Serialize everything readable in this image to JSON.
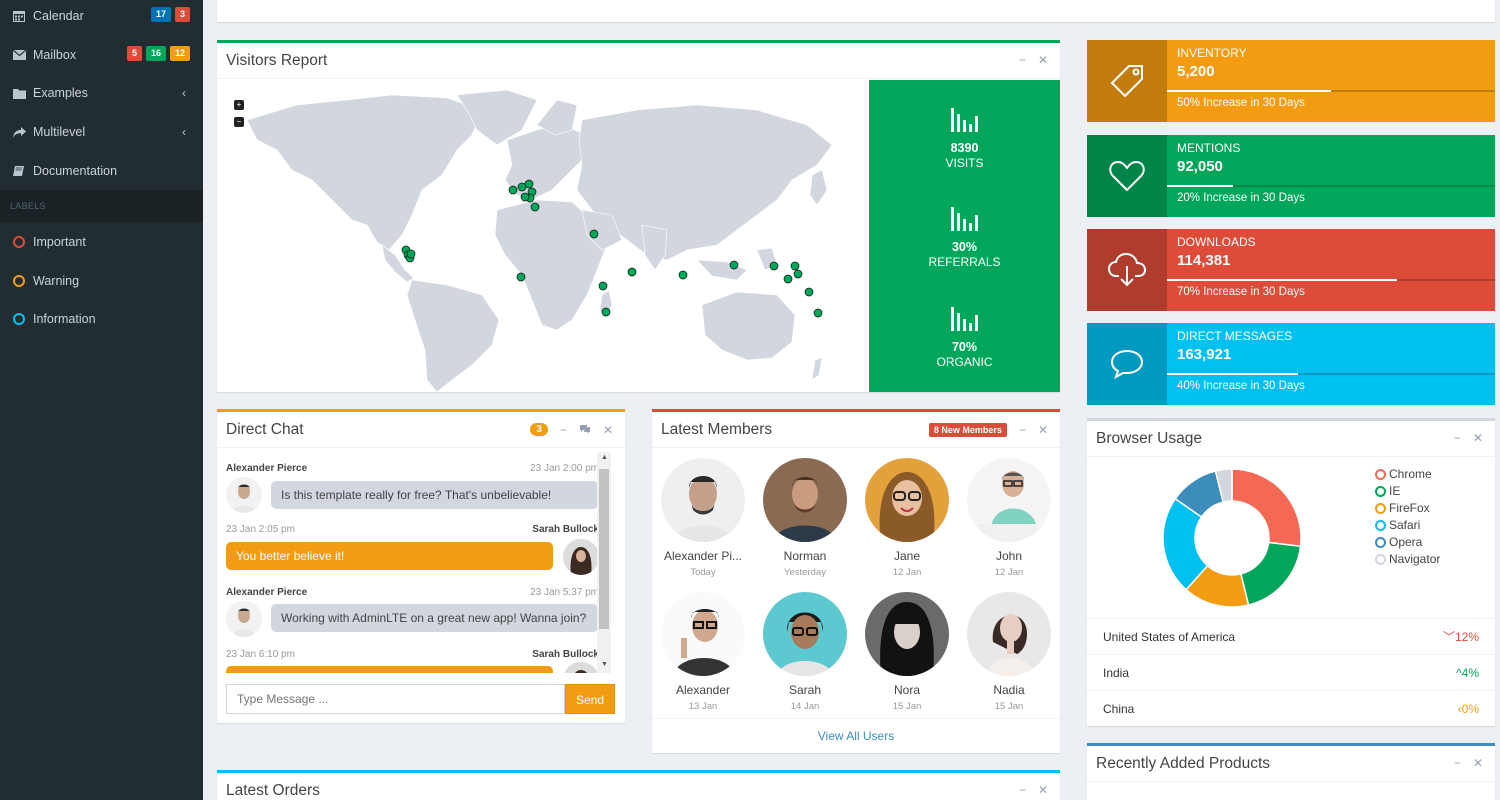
{
  "sidebar": {
    "items": [
      {
        "label": "Calendar",
        "icon": "calendar-icon",
        "badges": [
          {
            "text": "17",
            "color": "#0073b7"
          },
          {
            "text": "3",
            "color": "#dd4b39"
          }
        ]
      },
      {
        "label": "Mailbox",
        "icon": "envelope-icon",
        "badges": [
          {
            "text": "5",
            "color": "#dd4b39"
          },
          {
            "text": "16",
            "color": "#00a65a"
          },
          {
            "text": "12",
            "color": "#f39c12"
          }
        ]
      },
      {
        "label": "Examples",
        "icon": "folder-icon"
      },
      {
        "label": "Multilevel",
        "icon": "share-icon"
      },
      {
        "label": "Documentation",
        "icon": "book-icon"
      }
    ],
    "labels_header": "LABELS",
    "labels": [
      {
        "label": "Important",
        "color": "#dd4b39"
      },
      {
        "label": "Warning",
        "color": "#f39c12"
      },
      {
        "label": "Information",
        "color": "#00c0ef"
      }
    ]
  },
  "visitors": {
    "title": "Visitors Report",
    "stats": [
      {
        "value": "8390",
        "label": "VISITS"
      },
      {
        "value": "30%",
        "label": "REFERRALS"
      },
      {
        "value": "70%",
        "label": "ORGANIC"
      }
    ]
  },
  "info_boxes": [
    {
      "title": "INVENTORY",
      "number": "5,200",
      "desc": "50% Increase in 30 Days",
      "progress": 0.5,
      "color": "#f39c12",
      "icon": "tag-icon"
    },
    {
      "title": "MENTIONS",
      "number": "92,050",
      "desc": "20% Increase in 30 Days",
      "progress": 0.2,
      "color": "#00a65a",
      "icon": "heart-icon"
    },
    {
      "title": "DOWNLOADS",
      "number": "114,381",
      "desc": "70% Increase in 30 Days",
      "progress": 0.7,
      "color": "#dd4b39",
      "icon": "cloud-download-icon"
    },
    {
      "title": "DIRECT MESSAGES",
      "number": "163,921",
      "desc": "40% Increase in 30 Days",
      "progress": 0.4,
      "color": "#00c0ef",
      "icon": "comment-icon"
    }
  ],
  "chat": {
    "title": "Direct Chat",
    "badge": "3",
    "messages": [
      {
        "name": "Alexander Pierce",
        "time": "23 Jan 2:00 pm",
        "text": "Is this template really for free? That's unbelievable!"
      },
      {
        "name": "Sarah Bullock",
        "time": "23 Jan 2:05 pm",
        "text": "You better believe it!"
      },
      {
        "name": "Alexander Pierce",
        "time": "23 Jan 5:37 pm",
        "text": "Working with AdminLTE on a great new app! Wanna join?"
      },
      {
        "name": "Sarah Bullock",
        "time": "23 Jan 6:10 pm",
        "text": ""
      }
    ],
    "placeholder": "Type Message ...",
    "send": "Send"
  },
  "members": {
    "title": "Latest Members",
    "badge": "8 New Members",
    "list": [
      {
        "name": "Alexander Pi...",
        "date": "Today"
      },
      {
        "name": "Norman",
        "date": "Yesterday"
      },
      {
        "name": "Jane",
        "date": "12 Jan"
      },
      {
        "name": "John",
        "date": "12 Jan"
      },
      {
        "name": "Alexander",
        "date": "13 Jan"
      },
      {
        "name": "Sarah",
        "date": "14 Jan"
      },
      {
        "name": "Nora",
        "date": "15 Jan"
      },
      {
        "name": "Nadia",
        "date": "15 Jan"
      }
    ],
    "view_all": "View All Users"
  },
  "browser": {
    "title": "Browser Usage",
    "legend": [
      {
        "label": "Chrome",
        "color": "#f56954",
        "value": 700
      },
      {
        "label": "IE",
        "color": "#00a65a",
        "value": 500
      },
      {
        "label": "FireFox",
        "color": "#f39c12",
        "value": 400
      },
      {
        "label": "Safari",
        "color": "#00c0ef",
        "value": 600
      },
      {
        "label": "Opera",
        "color": "#3c8dbc",
        "value": 300
      },
      {
        "label": "Navigator",
        "color": "#d2d6de",
        "value": 100
      }
    ],
    "countries": [
      {
        "name": "United States of America",
        "change": "12%",
        "dir": "down",
        "color": "#dd4b39"
      },
      {
        "name": "India",
        "change": "4%",
        "dir": "up",
        "color": "#00a65a"
      },
      {
        "name": "China",
        "change": "0%",
        "dir": "left",
        "color": "#f39c12"
      }
    ]
  },
  "orders": {
    "title": "Latest Orders"
  },
  "products": {
    "title": "Recently Added Products"
  }
}
